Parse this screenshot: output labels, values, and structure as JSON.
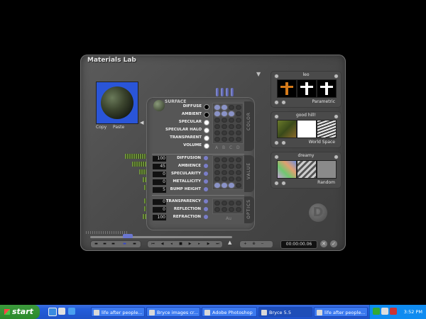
{
  "window": {
    "title": "Materials Lab",
    "preview": {
      "copy_label": "Copy",
      "paste_label": "Paste"
    },
    "surface": {
      "label": "SURFACE",
      "tab_label": "COLOR",
      "rows": [
        {
          "label": "DIFFUSE",
          "swatch": "black",
          "cells": [
            1,
            1,
            0,
            0
          ]
        },
        {
          "label": "AMBIENT",
          "swatch": "black",
          "cells": [
            1,
            1,
            1,
            0
          ]
        },
        {
          "label": "SPECULAR",
          "swatch": "white",
          "cells": [
            0,
            0,
            0,
            0
          ]
        },
        {
          "label": "SPECULAR HALO",
          "swatch": "white",
          "cells": [
            0,
            0,
            0,
            0
          ]
        },
        {
          "label": "TRANSPARENT",
          "swatch": "white",
          "cells": [
            0,
            0,
            0,
            0
          ]
        },
        {
          "label": "VOLUME",
          "swatch": "white",
          "cells": [
            0,
            0,
            0,
            0
          ]
        }
      ],
      "abcd": [
        "A",
        "B",
        "C",
        "D"
      ]
    },
    "value": {
      "tab_label": "VALUE",
      "rows": [
        {
          "label": "DIFFUSION",
          "value": "100"
        },
        {
          "label": "AMBIENCE",
          "value": "45"
        },
        {
          "label": "SPECULARITY",
          "value": "0"
        },
        {
          "label": "METALLICITY",
          "value": "0"
        },
        {
          "label": "BUMP HEIGHT",
          "value": "5"
        }
      ]
    },
    "optics": {
      "tab_label": "OPTICS",
      "rows": [
        {
          "label": "TRANSPARENCY",
          "value": "0"
        },
        {
          "label": "REFLECTION",
          "value": "0"
        },
        {
          "label": "REFRACTION",
          "value": "100"
        }
      ],
      "grid_label": "Au"
    },
    "libraries": [
      {
        "name": "leo",
        "category": "Parametric"
      },
      {
        "name": "good hill!",
        "category": "World Space"
      },
      {
        "name": "dreamy",
        "category": "Random"
      }
    ],
    "timecode": "00:00:00.06"
  },
  "taskbar": {
    "start_label": "start",
    "buttons": [
      {
        "label": "life after people..."
      },
      {
        "label": "Bryce images cr..."
      },
      {
        "label": "Adobe Photoshop"
      },
      {
        "label": "Bryce 5.5"
      },
      {
        "label": "life after people..."
      }
    ],
    "clock": "3:52 PM"
  }
}
